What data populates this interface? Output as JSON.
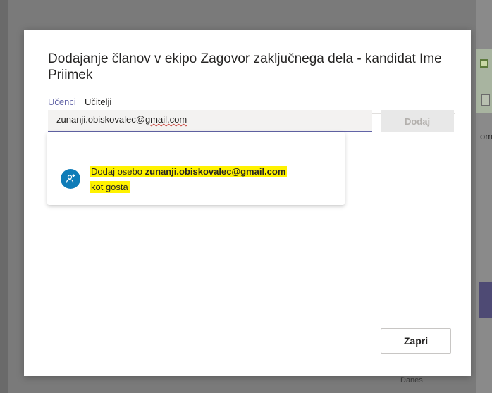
{
  "dialog": {
    "title": "Dodajanje članov v ekipo Zagovor zaključnega dela - kandidat Ime Priimek",
    "tabs": [
      {
        "label": "Učenci",
        "active": true
      },
      {
        "label": "Učitelji",
        "active": false
      }
    ],
    "search": {
      "value_prefix": "zunanji.obiskovalec@",
      "value_misspelled": "gmail.com"
    },
    "add_button_label": "Dodaj",
    "suggestion": {
      "prefix": "Dodaj osebo ",
      "email": "zunanji.obiskovalec@gmail.com",
      "suffix": "kot gosta",
      "icon": "add-guest-icon"
    },
    "close_button_label": "Zapri"
  },
  "background": {
    "right_text": "om",
    "bottom_text": "Danes"
  },
  "colors": {
    "accent": "#6264a7",
    "highlight": "#fff200",
    "avatar": "#0f7cb8"
  }
}
